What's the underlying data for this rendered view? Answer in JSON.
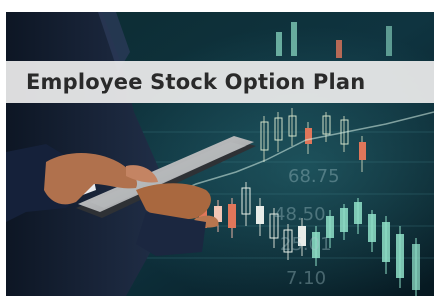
{
  "banner": {
    "title": "Employee Stock Option Plan"
  },
  "background": {
    "scene": "business-person-holding-tablet-over-stock-chart",
    "colors": {
      "dark_teal": "#0b2a33",
      "deep_navy": "#071822",
      "candle_green": "#8fe0c8",
      "candle_red": "#e0765a",
      "suit": "#1a2740",
      "skin": "#b0714d"
    },
    "overlay_numbers": [
      "68.75",
      "48.50",
      "25.01",
      "7.10"
    ]
  }
}
